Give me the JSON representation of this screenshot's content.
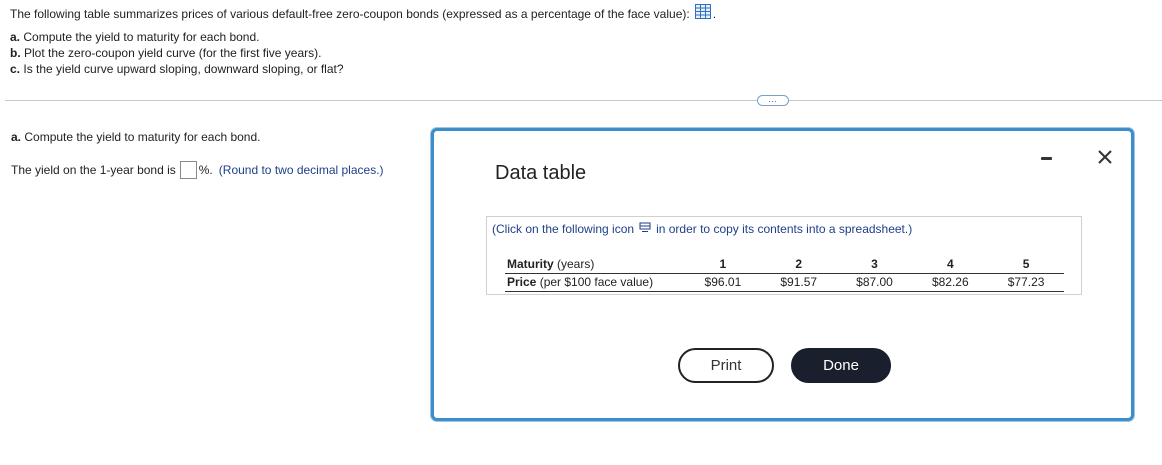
{
  "problem": {
    "intro": "The following table summarizes prices of various default-free zero-coupon bonds (expressed as a percentage of the face value):",
    "intro_end": ".",
    "table_icon": "table-grid-icon",
    "questions": [
      {
        "letter": "a.",
        "text": "Compute the yield to maturity for each bond."
      },
      {
        "letter": "b.",
        "text": "Plot the zero-coupon yield curve (for the first five years)."
      },
      {
        "letter": "c.",
        "text": "Is the yield curve upward sloping, downward sloping, or flat?"
      }
    ]
  },
  "expand_button": "…",
  "part_a": {
    "letter": "a.",
    "heading": "Compute the yield to maturity for each bond.",
    "answer_prefix": "The yield on the 1-year bond is",
    "answer_value": "",
    "answer_suffix": "%.",
    "hint": "(Round to two decimal places.)"
  },
  "modal": {
    "title": "Data table",
    "copy_prefix": "(Click on the following icon",
    "copy_suffix": "in order to copy its contents into a spreadsheet.)",
    "copy_icon": "copy-spreadsheet-icon",
    "rows": [
      {
        "label_bold": "Maturity",
        "label_rest": " (years)",
        "values": [
          "1",
          "2",
          "3",
          "4",
          "5"
        ]
      },
      {
        "label_bold": "Price",
        "label_rest": " (per $100 face value)",
        "values": [
          "$96.01",
          "$91.57",
          "$87.00",
          "$82.26",
          "$77.23"
        ]
      }
    ],
    "print_label": "Print",
    "done_label": "Done",
    "minimize_icon": "minimize-icon",
    "close_icon": "close-icon"
  },
  "colors": {
    "accent_border": "#3b8ec9",
    "hint_text": "#1e3f8a",
    "done_button": "#1a1f2e"
  }
}
